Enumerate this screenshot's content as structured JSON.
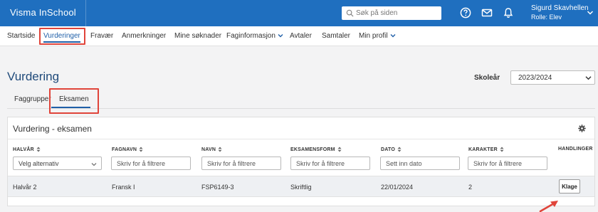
{
  "app": {
    "title": "Visma InSchool"
  },
  "search": {
    "placeholder": "Søk på siden"
  },
  "user": {
    "name": "Sigurd Skavhellen",
    "role": "Rolle: Elev"
  },
  "topbar_icons": [
    "help-icon",
    "mail-icon",
    "bell-icon"
  ],
  "nav": {
    "items": [
      {
        "label": "Startside",
        "active": false
      },
      {
        "label": "Vurderinger",
        "active": true
      },
      {
        "label": "Fravær",
        "active": false
      },
      {
        "label": "Anmerkninger",
        "active": false
      },
      {
        "label": "Mine søknader",
        "active": false
      },
      {
        "label": "Faginformasjon",
        "active": false,
        "dropdown": true
      },
      {
        "label": "Avtaler",
        "active": false
      },
      {
        "label": "Samtaler",
        "active": false
      },
      {
        "label": "Min profil",
        "active": false,
        "dropdown": true
      }
    ]
  },
  "page": {
    "title": "Vurdering"
  },
  "school_year": {
    "label": "Skoleår",
    "value": "2023/2024"
  },
  "subtabs": [
    {
      "label": "Faggrupper",
      "active": false
    },
    {
      "label": "Eksamen",
      "active": true
    }
  ],
  "card": {
    "title": "Vurdering - eksamen",
    "columns": [
      {
        "header": "HALVÅR",
        "filter_type": "select",
        "filter_text": "Velg alternativ"
      },
      {
        "header": "FAGNAVN",
        "filter_type": "text",
        "filter_text": "Skriv for å filtrere"
      },
      {
        "header": "NAVN",
        "filter_type": "text",
        "filter_text": "Skriv for å filtrere"
      },
      {
        "header": "EKSAMENSFORM",
        "filter_type": "text",
        "filter_text": "Skriv for å filtrere"
      },
      {
        "header": "DATO",
        "filter_type": "text",
        "filter_text": "Sett inn dato"
      },
      {
        "header": "KARAKTER",
        "filter_type": "text",
        "filter_text": "Skriv for å filtrere"
      },
      {
        "header": "HANDLINGER"
      }
    ],
    "rows": [
      {
        "halvar": "Halvår 2",
        "fagnavn": "Fransk I",
        "navn": "FSP6149-3",
        "eksamensform": "Skriftlig",
        "dato": "22/01/2024",
        "karakter": "2",
        "action_label": "Klage"
      }
    ]
  },
  "colors": {
    "topbar": "#1f6fbf",
    "accent": "#1f5fa8",
    "highlight": "#e0443a",
    "title": "#1f4a7a"
  }
}
